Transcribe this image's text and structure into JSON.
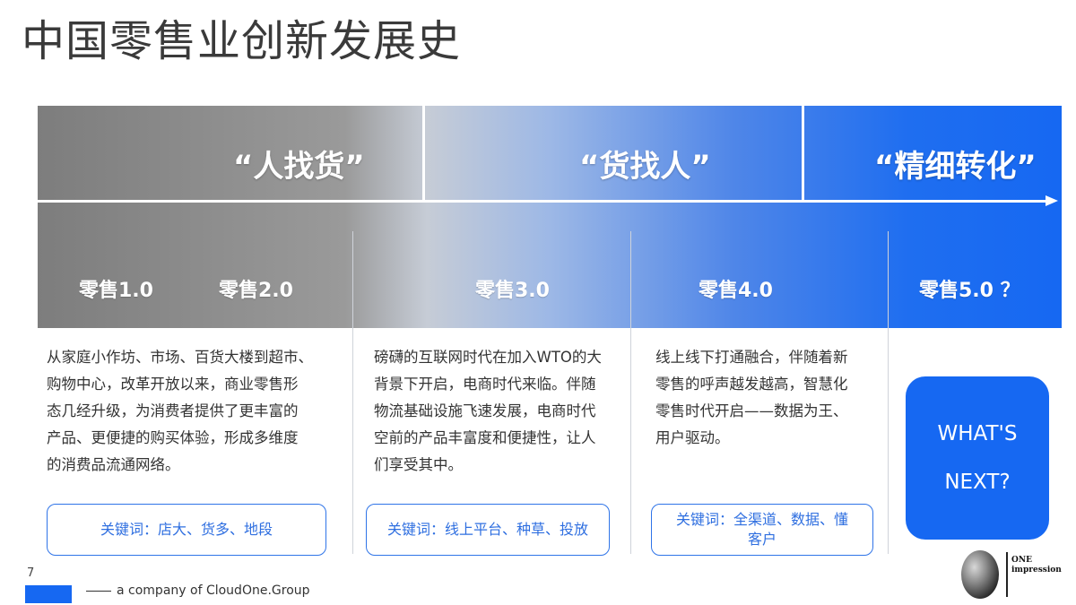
{
  "title": "中国零售业创新发展史",
  "phases": [
    {
      "label": "“人找货”"
    },
    {
      "label": "“货找人”"
    },
    {
      "label": "“精细转化”"
    }
  ],
  "eras": [
    {
      "label": "零售1.0"
    },
    {
      "label": "零售2.0"
    },
    {
      "label": "零售3.0"
    },
    {
      "label": "零售4.0"
    },
    {
      "label": "零售5.0 ？"
    }
  ],
  "columns": [
    {
      "lines": [
        "从家庭小作坊、市场、百货大楼到超市、",
        "购物中心，改革开放以来，商业零售形",
        "态几经升级，为消费者提供了更丰富的",
        "产品、更便捷的购买体验，形成多维度",
        "的消费品流通网络。"
      ],
      "keyword_lines": [
        "关键词：店大、货多、地段"
      ]
    },
    {
      "lines": [
        "磅礴的互联网时代在加入WTO的大",
        "背景下开启，电商时代来临。伴随",
        "物流基础设施飞速发展，电商时代",
        "空前的产品丰富度和便捷性，让人",
        "们享受其中。"
      ],
      "keyword_lines": [
        "关键词：线上平台、种草、投放"
      ]
    },
    {
      "lines": [
        "线上线下打通融合，伴随着新",
        "零售的呼声越发越高，智慧化",
        "零售时代开启——数据为王、",
        "用户驱动。"
      ],
      "keyword_lines": [
        "关键词：全渠道、数据、懂",
        "客户"
      ]
    }
  ],
  "whats_next": {
    "line1": "WHAT'S",
    "line2": "NEXT?"
  },
  "footer": {
    "page_number": "7",
    "company": "a company of CloudOne.Group"
  },
  "logo": {
    "line1": "ONE",
    "line2": "impression"
  },
  "colors": {
    "accent": "#1668f2",
    "gray": "#8a8a8a"
  }
}
